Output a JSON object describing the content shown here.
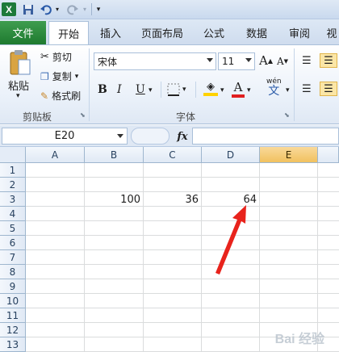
{
  "app": {
    "logo": "X",
    "icons": [
      "excel-logo-icon",
      "save-icon",
      "undo-icon",
      "redo-icon"
    ]
  },
  "tabs": {
    "file": "文件",
    "items": [
      "开始",
      "插入",
      "页面布局",
      "公式",
      "数据",
      "审阅",
      "视"
    ],
    "active_index": 0
  },
  "ribbon": {
    "clipboard": {
      "paste_label": "粘贴",
      "cut_label": "剪切",
      "copy_label": "复制",
      "format_painter_label": "格式刷",
      "group_label": "剪贴板"
    },
    "font": {
      "font_name": "宋体",
      "font_size": "11",
      "grow_label": "A",
      "shrink_label": "A",
      "bold": "B",
      "italic": "I",
      "underline": "U",
      "font_color_glyph": "A",
      "phonetic_top": "wén",
      "phonetic_bottom": "文",
      "group_label": "字体"
    },
    "colors": {
      "fill": "#ffd200",
      "font": "#e02020",
      "file_tab": "#217a33"
    }
  },
  "formula_bar": {
    "name_box": "E20",
    "fx": "fx",
    "value": ""
  },
  "sheet": {
    "columns": [
      "A",
      "B",
      "C",
      "D",
      "E"
    ],
    "selected_column": "E",
    "rows": [
      "1",
      "2",
      "3",
      "4",
      "5",
      "6",
      "7",
      "8",
      "9",
      "10",
      "11",
      "12",
      "13"
    ],
    "cells": {
      "B3": "100",
      "C3": "36",
      "D3": "64"
    }
  },
  "annotation": {
    "type": "arrow",
    "color": "#e8231c",
    "points_to": "D3"
  },
  "watermark": "Bai 经验"
}
